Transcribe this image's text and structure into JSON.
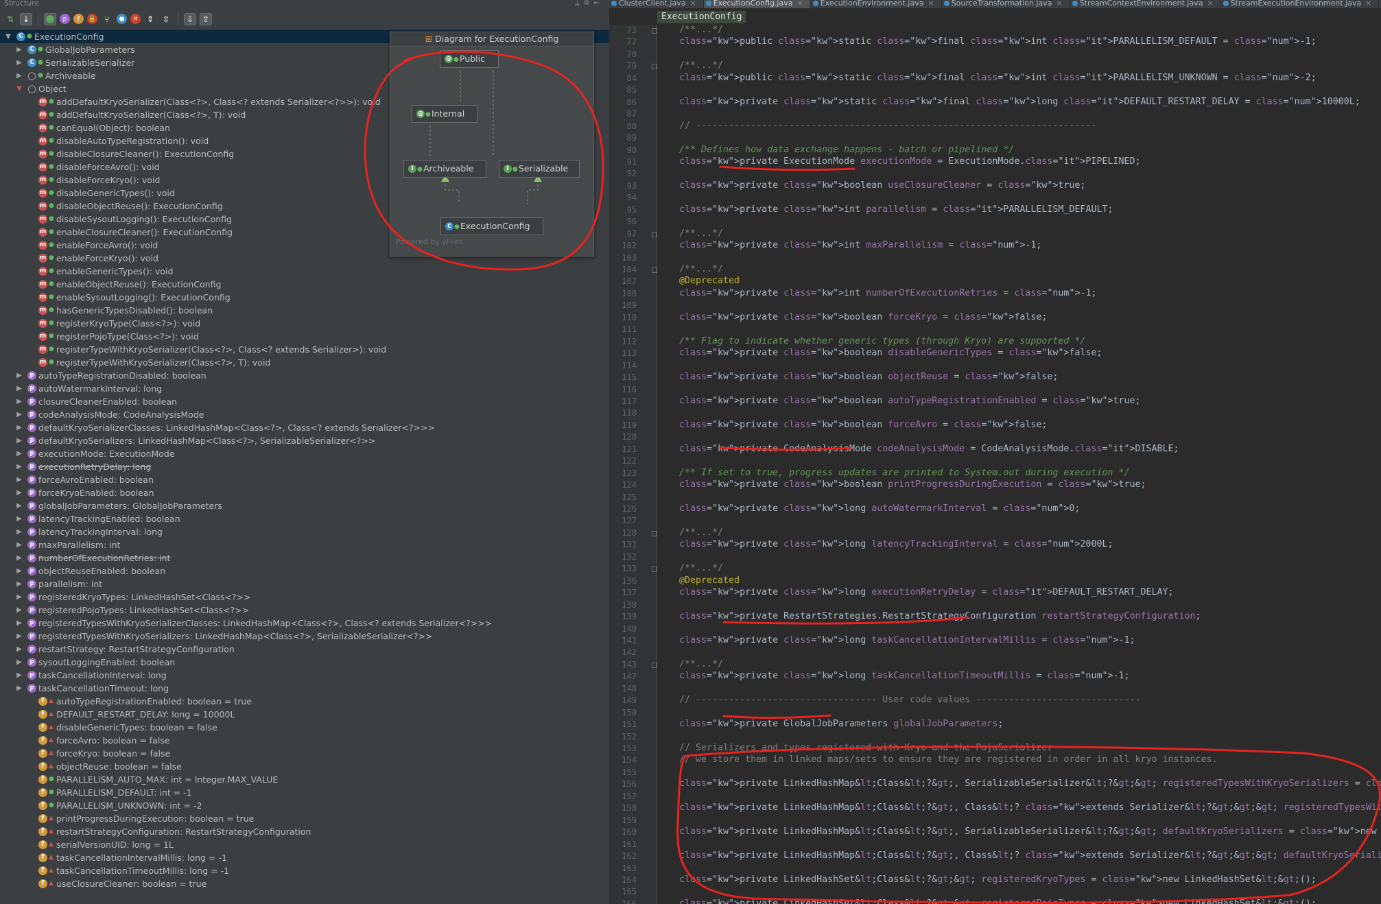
{
  "structure": {
    "header": "Structure",
    "tree": [
      {
        "level": 0,
        "arrow": "open",
        "icon": "c",
        "vis": "pub",
        "text": "ExecutionConfig",
        "selected": true
      },
      {
        "level": 1,
        "arrow": "closed",
        "icon": "c",
        "vis": "pub",
        "text": "GlobalJobParameters"
      },
      {
        "level": 1,
        "arrow": "closed",
        "icon": "c",
        "vis": "pub",
        "text": "SerializableSerializer"
      },
      {
        "level": 1,
        "arrow": "closed",
        "icon": "o",
        "vis": "pub",
        "text": "Archiveable"
      },
      {
        "level": 1,
        "arrow": "open-red",
        "icon": "o",
        "vis": "",
        "text": "Object"
      },
      {
        "level": 2,
        "arrow": "",
        "icon": "m",
        "vis": "pub",
        "text": "addDefaultKryoSerializer(Class<?>, Class<? extends Serializer<?>>): void"
      },
      {
        "level": 2,
        "arrow": "",
        "icon": "m",
        "vis": "pub",
        "text": "addDefaultKryoSerializer(Class<?>, T): void"
      },
      {
        "level": 2,
        "arrow": "",
        "icon": "m",
        "vis": "pub",
        "text": "canEqual(Object): boolean"
      },
      {
        "level": 2,
        "arrow": "",
        "icon": "m",
        "vis": "pub",
        "text": "disableAutoTypeRegistration(): void"
      },
      {
        "level": 2,
        "arrow": "",
        "icon": "m",
        "vis": "pub",
        "text": "disableClosureCleaner(): ExecutionConfig"
      },
      {
        "level": 2,
        "arrow": "",
        "icon": "m",
        "vis": "pub",
        "text": "disableForceAvro(): void"
      },
      {
        "level": 2,
        "arrow": "",
        "icon": "m",
        "vis": "pub",
        "text": "disableForceKryo(): void"
      },
      {
        "level": 2,
        "arrow": "",
        "icon": "m",
        "vis": "pub",
        "text": "disableGenericTypes(): void"
      },
      {
        "level": 2,
        "arrow": "",
        "icon": "m",
        "vis": "pub",
        "text": "disableObjectReuse(): ExecutionConfig"
      },
      {
        "level": 2,
        "arrow": "",
        "icon": "m",
        "vis": "pub",
        "text": "disableSysoutLogging(): ExecutionConfig"
      },
      {
        "level": 2,
        "arrow": "",
        "icon": "m",
        "vis": "pub",
        "text": "enableClosureCleaner(): ExecutionConfig"
      },
      {
        "level": 2,
        "arrow": "",
        "icon": "m",
        "vis": "pub",
        "text": "enableForceAvro(): void"
      },
      {
        "level": 2,
        "arrow": "",
        "icon": "m",
        "vis": "pub",
        "text": "enableForceKryo(): void"
      },
      {
        "level": 2,
        "arrow": "",
        "icon": "m",
        "vis": "pub",
        "text": "enableGenericTypes(): void"
      },
      {
        "level": 2,
        "arrow": "",
        "icon": "m",
        "vis": "pub",
        "text": "enableObjectReuse(): ExecutionConfig"
      },
      {
        "level": 2,
        "arrow": "",
        "icon": "m",
        "vis": "pub",
        "text": "enableSysoutLogging(): ExecutionConfig"
      },
      {
        "level": 2,
        "arrow": "",
        "icon": "m",
        "vis": "pub",
        "text": "hasGenericTypesDisabled(): boolean"
      },
      {
        "level": 2,
        "arrow": "",
        "icon": "m",
        "vis": "pub",
        "text": "registerKryoType(Class<?>): void"
      },
      {
        "level": 2,
        "arrow": "",
        "icon": "m",
        "vis": "pub",
        "text": "registerPojoType(Class<?>): void"
      },
      {
        "level": 2,
        "arrow": "",
        "icon": "m",
        "vis": "pub",
        "text": "registerTypeWithKryoSerializer(Class<?>, Class<? extends Serializer>): void"
      },
      {
        "level": 2,
        "arrow": "",
        "icon": "m",
        "vis": "pub",
        "text": "registerTypeWithKryoSerializer(Class<?>, T): void"
      },
      {
        "level": 1,
        "arrow": "closed",
        "icon": "p",
        "vis": "",
        "text": "autoTypeRegistrationDisabled: boolean"
      },
      {
        "level": 1,
        "arrow": "closed",
        "icon": "p",
        "vis": "",
        "text": "autoWatermarkInterval: long"
      },
      {
        "level": 1,
        "arrow": "closed",
        "icon": "p",
        "vis": "",
        "text": "closureCleanerEnabled: boolean"
      },
      {
        "level": 1,
        "arrow": "closed",
        "icon": "p",
        "vis": "",
        "text": "codeAnalysisMode: CodeAnalysisMode"
      },
      {
        "level": 1,
        "arrow": "closed",
        "icon": "p",
        "vis": "",
        "text": "defaultKryoSerializerClasses: LinkedHashMap<Class<?>, Class<? extends Serializer<?>>>"
      },
      {
        "level": 1,
        "arrow": "closed",
        "icon": "p",
        "vis": "",
        "text": "defaultKryoSerializers: LinkedHashMap<Class<?>, SerializableSerializer<?>>"
      },
      {
        "level": 1,
        "arrow": "closed",
        "icon": "p",
        "vis": "",
        "text": "executionMode: ExecutionMode"
      },
      {
        "level": 1,
        "arrow": "closed",
        "icon": "p",
        "vis": "",
        "text": "executionRetryDelay: long",
        "strike": true
      },
      {
        "level": 1,
        "arrow": "closed",
        "icon": "p",
        "vis": "",
        "text": "forceAvroEnabled: boolean"
      },
      {
        "level": 1,
        "arrow": "closed",
        "icon": "p",
        "vis": "",
        "text": "forceKryoEnabled: boolean"
      },
      {
        "level": 1,
        "arrow": "closed",
        "icon": "p",
        "vis": "",
        "text": "globalJobParameters: GlobalJobParameters"
      },
      {
        "level": 1,
        "arrow": "closed",
        "icon": "p",
        "vis": "",
        "text": "latencyTrackingEnabled: boolean"
      },
      {
        "level": 1,
        "arrow": "closed",
        "icon": "p",
        "vis": "",
        "text": "latencyTrackingInterval: long"
      },
      {
        "level": 1,
        "arrow": "closed",
        "icon": "p",
        "vis": "",
        "text": "maxParallelism: int"
      },
      {
        "level": 1,
        "arrow": "closed",
        "icon": "p",
        "vis": "",
        "text": "numberOfExecutionRetries: int",
        "strike": true
      },
      {
        "level": 1,
        "arrow": "closed",
        "icon": "p",
        "vis": "",
        "text": "objectReuseEnabled: boolean"
      },
      {
        "level": 1,
        "arrow": "closed",
        "icon": "p",
        "vis": "",
        "text": "parallelism: int"
      },
      {
        "level": 1,
        "arrow": "closed",
        "icon": "p",
        "vis": "",
        "text": "registeredKryoTypes: LinkedHashSet<Class<?>>"
      },
      {
        "level": 1,
        "arrow": "closed",
        "icon": "p",
        "vis": "",
        "text": "registeredPojoTypes: LinkedHashSet<Class<?>>"
      },
      {
        "level": 1,
        "arrow": "closed",
        "icon": "p",
        "vis": "",
        "text": "registeredTypesWithKryoSerializerClasses: LinkedHashMap<Class<?>, Class<? extends Serializer<?>>>"
      },
      {
        "level": 1,
        "arrow": "closed",
        "icon": "p",
        "vis": "",
        "text": "registeredTypesWithKryoSerializers: LinkedHashMap<Class<?>, SerializableSerializer<?>>"
      },
      {
        "level": 1,
        "arrow": "closed",
        "icon": "p",
        "vis": "",
        "text": "restartStrategy: RestartStrategyConfiguration"
      },
      {
        "level": 1,
        "arrow": "closed",
        "icon": "p",
        "vis": "",
        "text": "sysoutLoggingEnabled: boolean"
      },
      {
        "level": 1,
        "arrow": "closed",
        "icon": "p",
        "vis": "",
        "text": "taskCancellationInterval: long"
      },
      {
        "level": 1,
        "arrow": "closed",
        "icon": "p",
        "vis": "",
        "text": "taskCancellationTimeout: long"
      },
      {
        "level": 2,
        "arrow": "",
        "icon": "f",
        "vis": "priv",
        "text": "autoTypeRegistrationEnabled: boolean = true"
      },
      {
        "level": 2,
        "arrow": "",
        "icon": "f",
        "vis": "priv",
        "text": "DEFAULT_RESTART_DELAY: long = 10000L"
      },
      {
        "level": 2,
        "arrow": "",
        "icon": "f",
        "vis": "priv",
        "text": "disableGenericTypes: boolean = false"
      },
      {
        "level": 2,
        "arrow": "",
        "icon": "f",
        "vis": "priv",
        "text": "forceAvro: boolean = false"
      },
      {
        "level": 2,
        "arrow": "",
        "icon": "f",
        "vis": "priv",
        "text": "forceKryo: boolean = false"
      },
      {
        "level": 2,
        "arrow": "",
        "icon": "f",
        "vis": "priv",
        "text": "objectReuse: boolean = false"
      },
      {
        "level": 2,
        "arrow": "",
        "icon": "f",
        "vis": "pub",
        "text": "PARALLELISM_AUTO_MAX: int = Integer.MAX_VALUE"
      },
      {
        "level": 2,
        "arrow": "",
        "icon": "f",
        "vis": "pub",
        "text": "PARALLELISM_DEFAULT: int = -1"
      },
      {
        "level": 2,
        "arrow": "",
        "icon": "f",
        "vis": "pub",
        "text": "PARALLELISM_UNKNOWN: int = -2"
      },
      {
        "level": 2,
        "arrow": "",
        "icon": "f",
        "vis": "priv",
        "text": "printProgressDuringExecution: boolean = true"
      },
      {
        "level": 2,
        "arrow": "",
        "icon": "f",
        "vis": "priv",
        "text": "restartStrategyConfiguration: RestartStrategyConfiguration"
      },
      {
        "level": 2,
        "arrow": "",
        "icon": "f",
        "vis": "priv",
        "text": "serialVersionUID: long = 1L"
      },
      {
        "level": 2,
        "arrow": "",
        "icon": "f",
        "vis": "priv",
        "text": "taskCancellationIntervalMillis: long = -1"
      },
      {
        "level": 2,
        "arrow": "",
        "icon": "f",
        "vis": "priv",
        "text": "taskCancellationTimeoutMillis: long = -1"
      },
      {
        "level": 2,
        "arrow": "",
        "icon": "f",
        "vis": "priv",
        "text": "useClosureCleaner: boolean = true"
      }
    ]
  },
  "diagram": {
    "title": "Diagram for ExecutionConfig",
    "nodes": {
      "public": "Public",
      "internal": "Internal",
      "archiveable": "Archiveable",
      "serializable": "Serializable",
      "execution_config": "ExecutionConfig"
    },
    "powered": "Powered by yFiles"
  },
  "editor": {
    "tabs": [
      {
        "label": "ClusterClient.java",
        "active": false
      },
      {
        "label": "ExecutionConfig.java",
        "active": true
      },
      {
        "label": "ExecutionEnvironment.java",
        "active": false
      },
      {
        "label": "SourceTransformation.java",
        "active": false
      },
      {
        "label": "StreamContextEnvironment.java",
        "active": false
      },
      {
        "label": "StreamExecutionEnvironment.java",
        "active": false
      }
    ],
    "breadcrumb": "ExecutionConfig",
    "lines": [
      {
        "n": "73",
        "t": "/**...*/",
        "fold": true
      },
      {
        "n": "77",
        "t": "public static final int PARALLELISM_DEFAULT = -1;"
      },
      {
        "n": "78",
        "t": ""
      },
      {
        "n": "79",
        "t": "/**...*/",
        "fold": true
      },
      {
        "n": "84",
        "t": "public static final int PARALLELISM_UNKNOWN = -2;"
      },
      {
        "n": "85",
        "t": ""
      },
      {
        "n": "86",
        "t": "private static final long DEFAULT_RESTART_DELAY = 10000L;"
      },
      {
        "n": "87",
        "t": ""
      },
      {
        "n": "88",
        "t": "// -------------------------------------------------------------------------"
      },
      {
        "n": "89",
        "t": ""
      },
      {
        "n": "90",
        "t": "/** Defines how data exchange happens - batch or pipelined */"
      },
      {
        "n": "91",
        "t": "private ExecutionMode executionMode = ExecutionMode.PIPELINED;"
      },
      {
        "n": "92",
        "t": ""
      },
      {
        "n": "93",
        "t": "private boolean useClosureCleaner = true;"
      },
      {
        "n": "94",
        "t": ""
      },
      {
        "n": "95",
        "t": "private int parallelism = PARALLELISM_DEFAULT;"
      },
      {
        "n": "96",
        "t": ""
      },
      {
        "n": "97",
        "t": "/**...*/",
        "fold": true
      },
      {
        "n": "102",
        "t": "private int maxParallelism = -1;"
      },
      {
        "n": "103",
        "t": ""
      },
      {
        "n": "104",
        "t": "/**...*/",
        "fold": true
      },
      {
        "n": "107",
        "t": "@Deprecated"
      },
      {
        "n": "108",
        "t": "private int numberOfExecutionRetries = -1;"
      },
      {
        "n": "109",
        "t": ""
      },
      {
        "n": "110",
        "t": "private boolean forceKryo = false;"
      },
      {
        "n": "111",
        "t": ""
      },
      {
        "n": "112",
        "t": "/** Flag to indicate whether generic types (through Kryo) are supported */"
      },
      {
        "n": "113",
        "t": "private boolean disableGenericTypes = false;"
      },
      {
        "n": "114",
        "t": ""
      },
      {
        "n": "115",
        "t": "private boolean objectReuse = false;"
      },
      {
        "n": "116",
        "t": ""
      },
      {
        "n": "117",
        "t": "private boolean autoTypeRegistrationEnabled = true;"
      },
      {
        "n": "118",
        "t": ""
      },
      {
        "n": "119",
        "t": "private boolean forceAvro = false;"
      },
      {
        "n": "120",
        "t": ""
      },
      {
        "n": "121",
        "t": "private CodeAnalysisMode codeAnalysisMode = CodeAnalysisMode.DISABLE;"
      },
      {
        "n": "122",
        "t": ""
      },
      {
        "n": "123",
        "t": "/** If set to true, progress updates are printed to System.out during execution */"
      },
      {
        "n": "124",
        "t": "private boolean printProgressDuringExecution = true;"
      },
      {
        "n": "125",
        "t": ""
      },
      {
        "n": "126",
        "t": "private long autoWatermarkInterval = 0;"
      },
      {
        "n": "127",
        "t": ""
      },
      {
        "n": "128",
        "t": "/**...*/",
        "fold": true
      },
      {
        "n": "131",
        "t": "private long latencyTrackingInterval = 2000L;"
      },
      {
        "n": "132",
        "t": ""
      },
      {
        "n": "133",
        "t": "/**...*/",
        "fold": true
      },
      {
        "n": "136",
        "t": "@Deprecated"
      },
      {
        "n": "137",
        "t": "private long executionRetryDelay = DEFAULT_RESTART_DELAY;"
      },
      {
        "n": "138",
        "t": ""
      },
      {
        "n": "139",
        "t": "private RestartStrategies.RestartStrategyConfiguration restartStrategyConfiguration;"
      },
      {
        "n": "140",
        "t": ""
      },
      {
        "n": "141",
        "t": "private long taskCancellationIntervalMillis = -1;"
      },
      {
        "n": "142",
        "t": ""
      },
      {
        "n": "143",
        "t": "/**...*/",
        "fold": true
      },
      {
        "n": "147",
        "t": "private long taskCancellationTimeoutMillis = -1;"
      },
      {
        "n": "148",
        "t": ""
      },
      {
        "n": "149",
        "t": "// --------------------------------- User code values ------------------------------"
      },
      {
        "n": "150",
        "t": ""
      },
      {
        "n": "151",
        "t": "private GlobalJobParameters globalJobParameters;"
      },
      {
        "n": "152",
        "t": ""
      },
      {
        "n": "153",
        "t": "// Serializers and types registered with Kryo and the PojoSerializer"
      },
      {
        "n": "154",
        "t": "// we store them in linked maps/sets to ensure they are registered in order in all kryo instances."
      },
      {
        "n": "155",
        "t": ""
      },
      {
        "n": "156",
        "t": "private LinkedHashMap<Class<?>, SerializableSerializer<?>> registeredTypesWithKryoSerializers = new LinkedHashMap<>();"
      },
      {
        "n": "157",
        "t": ""
      },
      {
        "n": "158",
        "t": "private LinkedHashMap<Class<?>, Class<? extends Serializer<?>>> registeredTypesWithKryoSerializerClasses = new LinkedHashMap<>();"
      },
      {
        "n": "159",
        "t": ""
      },
      {
        "n": "160",
        "t": "private LinkedHashMap<Class<?>, SerializableSerializer<?>> defaultKryoSerializers = new LinkedHashMap<>();"
      },
      {
        "n": "161",
        "t": ""
      },
      {
        "n": "162",
        "t": "private LinkedHashMap<Class<?>, Class<? extends Serializer<?>>> defaultKryoSerializerClasses = new LinkedHashMap<>();"
      },
      {
        "n": "163",
        "t": ""
      },
      {
        "n": "164",
        "t": "private LinkedHashSet<Class<?>> registeredKryoTypes = new LinkedHashSet<>();"
      },
      {
        "n": "165",
        "t": ""
      },
      {
        "n": "166",
        "t": "private LinkedHashSet<Class<?>> registeredPojoTypes = new LinkedHashSet<>();"
      },
      {
        "n": "167",
        "t": ""
      }
    ]
  },
  "colors": {
    "annotation": "#e8231f",
    "selection": "#0d293e",
    "keyword": "#cc7832",
    "field": "#9876aa"
  }
}
